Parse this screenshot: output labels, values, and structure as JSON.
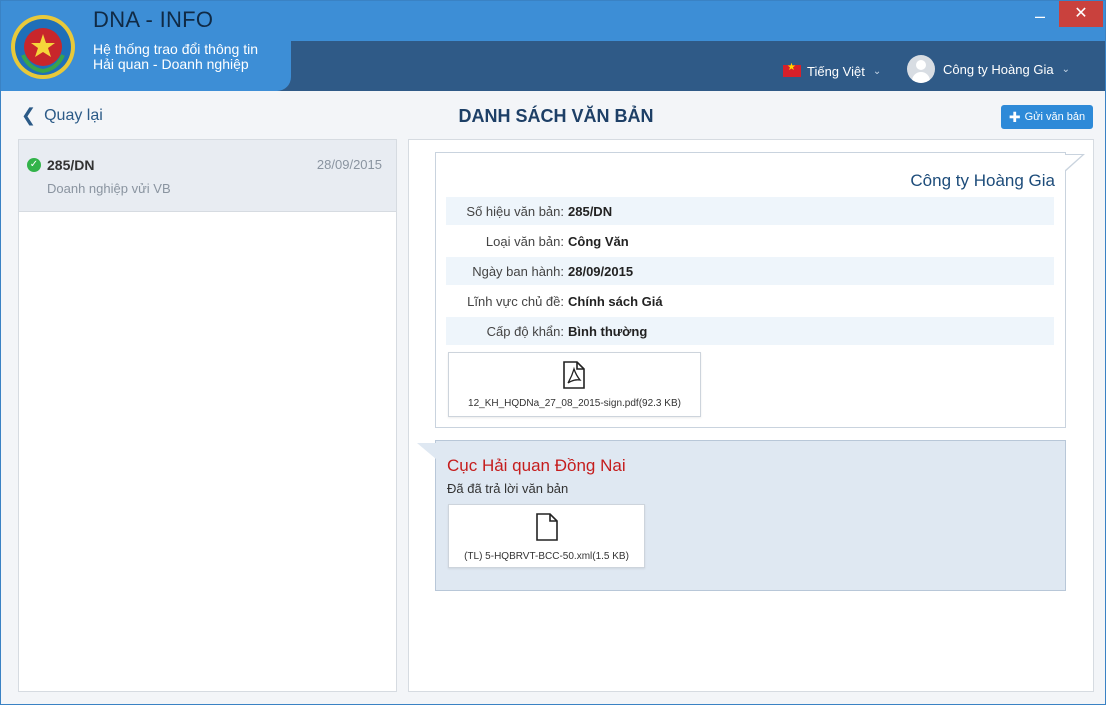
{
  "app": {
    "title": "DNA - INFO",
    "subtitle_line1": "Hệ thống trao đổi thông tin",
    "subtitle_line2": "Hải quan - Doanh nghiệp",
    "window_min": "–",
    "window_close": "✕"
  },
  "header": {
    "language": "Tiếng Việt",
    "user": "Công ty Hoàng Gia",
    "caret": "⌄"
  },
  "toolbar": {
    "back_label": "Quay lại",
    "page_title": "DANH SÁCH VĂN BẢN",
    "send_label": "Gửi văn bản"
  },
  "list": {
    "items": [
      {
        "number": "285/DN",
        "date": "28/09/2015",
        "description": "Doanh nghiệp vửi VB"
      }
    ]
  },
  "document": {
    "sender": "Công ty Hoàng Gia",
    "fields": [
      {
        "label": "Số hiệu văn bản:",
        "value": "285/DN"
      },
      {
        "label": "Loại văn bản:",
        "value": "Công Văn"
      },
      {
        "label": "Ngày ban hành:",
        "value": "28/09/2015"
      },
      {
        "label": "Lĩnh vực chủ đề:",
        "value": "Chính sách Giá"
      },
      {
        "label": "Cấp độ khẩn:",
        "value": "Bình thường"
      }
    ],
    "attachment": "12_KH_HQDNa_27_08_2015-sign.pdf(92.3 KB)"
  },
  "reply": {
    "sender": "Cục Hải quan Đồng Nai",
    "text": "Đã đã trả lời văn bản",
    "attachment": "(TL) 5-HQBRVT-BCC-50.xml(1.5 KB)"
  },
  "colors": {
    "titlebar": "#3d8ed6",
    "header_band": "#2f5a87",
    "accent": "#2e8ad8",
    "reply_sender": "#c51d1d"
  }
}
